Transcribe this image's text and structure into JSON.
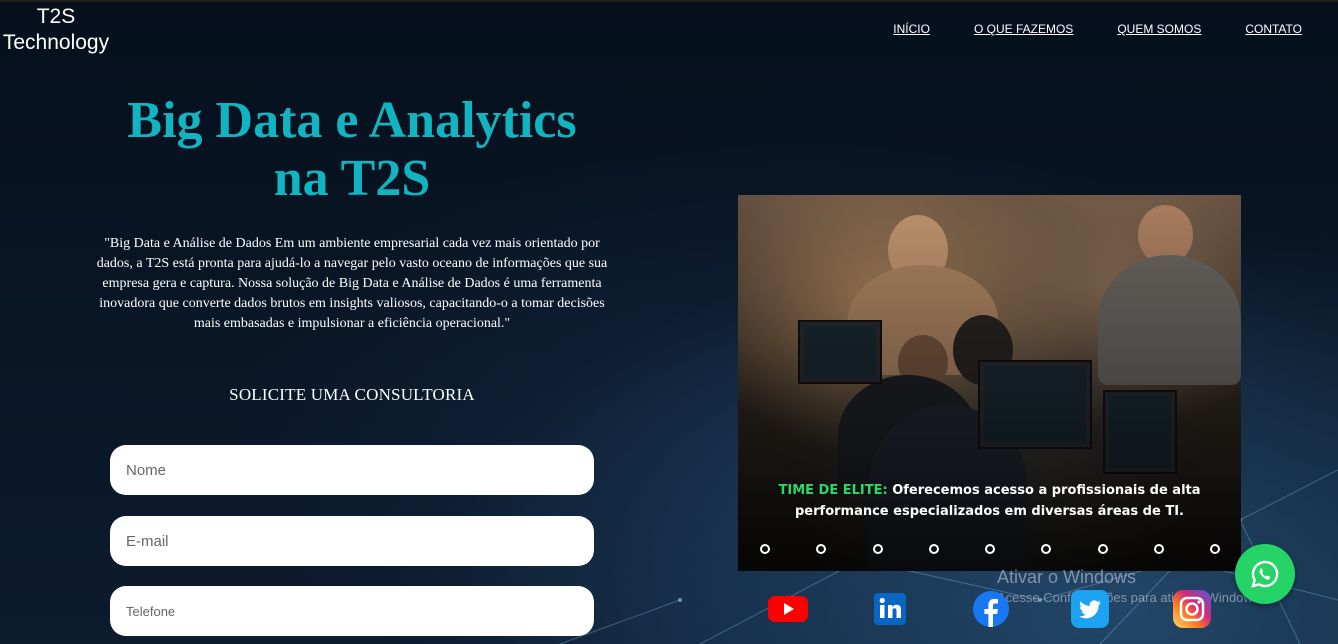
{
  "brand": {
    "line1": "T2S",
    "line2": "Technology"
  },
  "nav": [
    {
      "label": "INÍCIO"
    },
    {
      "label": "O QUE FAZEMOS"
    },
    {
      "label": "QUEM SOMOS"
    },
    {
      "label": "CONTATO"
    }
  ],
  "hero": {
    "title_line1": "Big Data e Analytics",
    "title_line2": "na T2S",
    "description": "\"Big Data e Análise de Dados Em um ambiente empresarial cada vez mais orientado por dados, a T2S está pronta para ajudá-lo a navegar pelo vasto oceano de informações que sua empresa gera e captura. Nossa solução de Big Data e Análise de Dados é uma ferramenta inovadora que converte dados brutos em insights valiosos, capacitando-o a tomar decisões mais embasadas e impulsionar a eficiência operacional.\"",
    "title_color": "#12b4c1"
  },
  "form": {
    "heading": "SOLICITE UMA CONSULTORIA",
    "name_placeholder": "Nome",
    "email_placeholder": "E-mail",
    "phone_placeholder": "Telefone"
  },
  "carousel": {
    "caption_accent": "TIME DE ELITE:",
    "caption_line1": " Oferecemos acesso a profissionais de alta",
    "caption_line2": "performance especializados em diversas áreas de TI.",
    "accent_color": "#2dd86b",
    "slide_count": 9
  },
  "socials": [
    "youtube-icon",
    "linkedin-icon",
    "facebook-icon",
    "twitter-icon",
    "instagram-icon"
  ],
  "windows_watermark": {
    "title": "Ativar o Windows",
    "subtitle": "Acesse Configurações para ativar o Windows."
  },
  "whatsapp": {
    "icon": "whatsapp-icon",
    "color": "#25d366"
  }
}
